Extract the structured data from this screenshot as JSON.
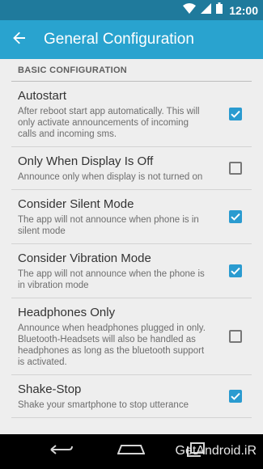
{
  "status_bar": {
    "time": "12:00",
    "icons": [
      "wifi-icon",
      "signal-icon",
      "battery-icon"
    ]
  },
  "app_bar": {
    "title": "General Configuration",
    "back_icon": "arrow-back-icon",
    "color": "#29a3cf"
  },
  "section": {
    "header": "BASIC CONFIGURATION"
  },
  "settings": [
    {
      "title": "Autostart",
      "summary": "After reboot start app automatically. This will only activate announcements of incoming calls and incoming sms.",
      "checked": true
    },
    {
      "title": "Only When Display Is Off",
      "summary": "Announce only when display is not turned on",
      "checked": false
    },
    {
      "title": "Consider Silent Mode",
      "summary": "The app will not announce when phone is in silent mode",
      "checked": true
    },
    {
      "title": "Consider Vibration Mode",
      "summary": "The app will not announce when the phone is in vibration mode",
      "checked": true
    },
    {
      "title": "Headphones Only",
      "summary": "Announce when headphones plugged in only. Bluetooth-Headsets will also be handled as headphones as long as the bluetooth support is activated.",
      "checked": false
    },
    {
      "title": "Shake-Stop",
      "summary": "Shake your smartphone to stop utterance",
      "checked": true
    }
  ],
  "nav_bar": {
    "icons": [
      "back-icon",
      "home-icon",
      "recents-icon"
    ],
    "watermark": "GetAndroid.iR"
  },
  "colors": {
    "accent": "#2a9bd0",
    "status_bar": "#1f7a9c",
    "background": "#eeeeee"
  }
}
